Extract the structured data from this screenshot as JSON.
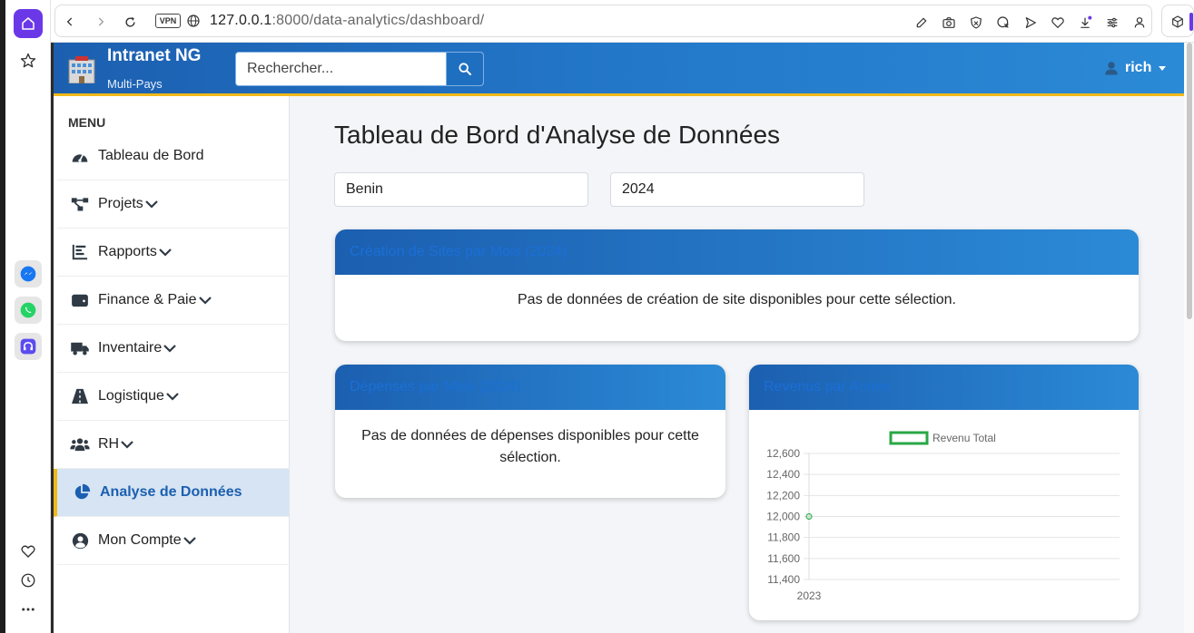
{
  "browser": {
    "url_host": "127.0.0.1",
    "url_rest": ":8000/data-analytics/dashboard/",
    "vpn_label": "VPN"
  },
  "header": {
    "brand": "Intranet NG",
    "subtitle": "Multi-Pays",
    "search_placeholder": "Rechercher...",
    "user": "rich"
  },
  "sidebar": {
    "title": "MENU",
    "items": [
      {
        "label": "Tableau de Bord",
        "icon": "gauge-icon"
      },
      {
        "label": "Projets",
        "icon": "project-diagram-icon"
      },
      {
        "label": "Rapports",
        "icon": "bar-chart-icon"
      },
      {
        "label": "Finance & Paie",
        "icon": "wallet-icon"
      },
      {
        "label": "Inventaire",
        "icon": "truck-icon"
      },
      {
        "label": "Logistique",
        "icon": "road-icon"
      },
      {
        "label": "RH",
        "icon": "users-icon"
      },
      {
        "label": "Analyse de Données",
        "icon": "pie-chart-icon"
      },
      {
        "label": "Mon Compte",
        "icon": "user-circle-icon"
      }
    ]
  },
  "main": {
    "title": "Tableau de Bord d'Analyse de Données",
    "filters": {
      "country": "Benin",
      "year": "2024"
    },
    "card_sites": {
      "title": "Création de Sites par Mois (2024)",
      "message": "Pas de données de création de site disponibles pour cette sélection."
    },
    "card_expenses": {
      "title": "Dépenses par Mois (2024)",
      "message": "Pas de données de dépenses disponibles pour cette sélection."
    },
    "card_revenue": {
      "title": "Revenus par Année"
    }
  },
  "chart_data": {
    "type": "line",
    "x": [
      "2023"
    ],
    "series": [
      {
        "name": "Revenu Total",
        "values": [
          12000
        ],
        "color": "#28a745"
      }
    ],
    "ylim": [
      11400,
      12600
    ],
    "yticks": [
      "12,600",
      "12,400",
      "12,200",
      "12,000",
      "11,800",
      "11,600",
      "11,400"
    ],
    "grid": true,
    "legend": "top"
  },
  "colors": {
    "header_blue": "#1c5fb0",
    "accent_yellow": "#f0b81b",
    "series_green": "#28a745"
  }
}
